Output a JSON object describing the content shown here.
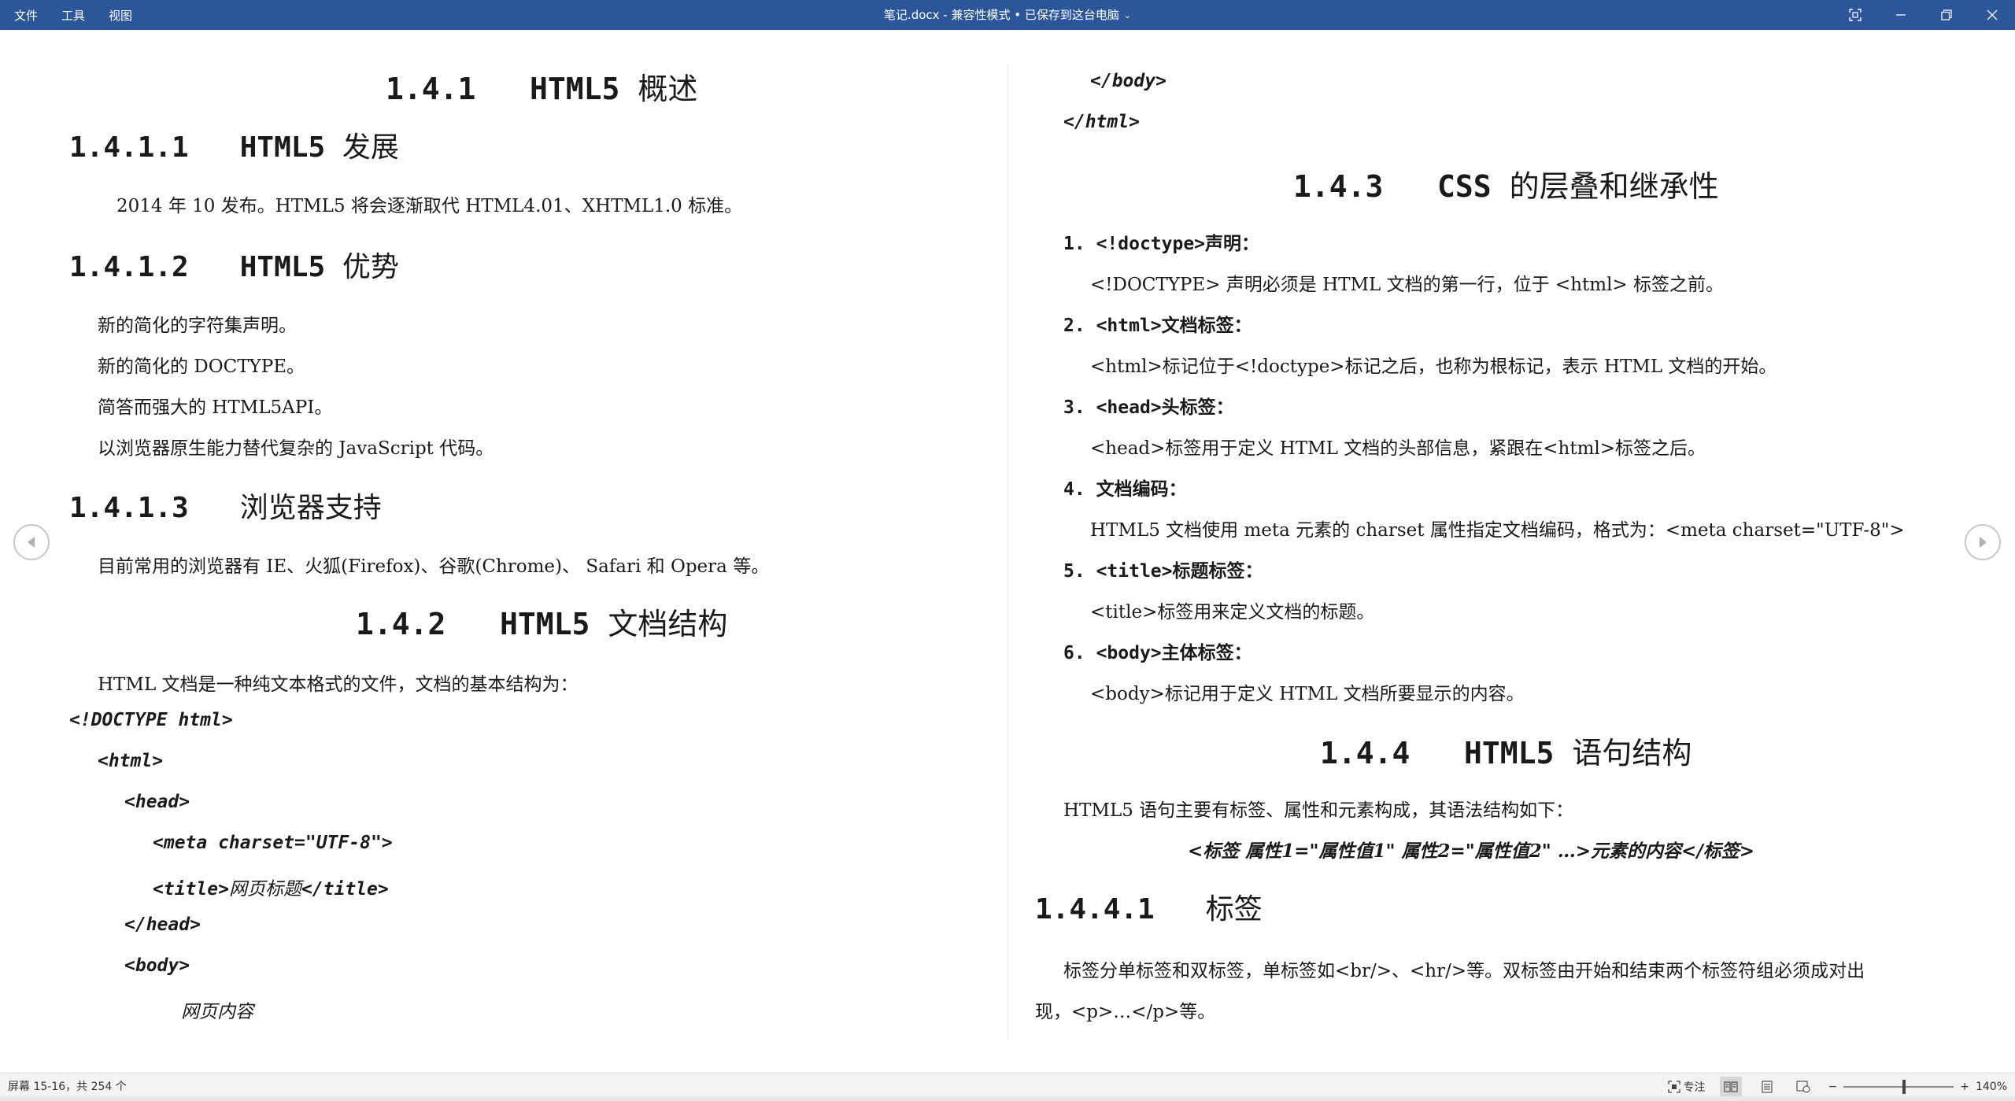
{
  "titlebar": {
    "menu": [
      "文件",
      "工具",
      "视图"
    ],
    "title": "笔记.docx - 兼容性模式 • 已保存到这台电脑",
    "controls": [
      "fit-window-icon",
      "minimize-icon",
      "restore-icon",
      "close-icon"
    ]
  },
  "left": {
    "h_141": {
      "num": "1.4.1",
      "mono": "HTML5",
      "cn": "概述"
    },
    "h_1411": {
      "num": "1.4.1.1",
      "mono": "HTML5",
      "cn": "发展"
    },
    "p_1411": "2014 年 10 发布。HTML5 将会逐渐取代 HTML4.01、XHTML1.0 标准。",
    "h_1412": {
      "num": "1.4.1.2",
      "mono": "HTML5",
      "cn": "优势"
    },
    "adv": [
      "新的简化的字符集声明。",
      "新的简化的 DOCTYPE。",
      "简答而强大的 HTML5API。",
      "以浏览器原生能力替代复杂的 JavaScript 代码。"
    ],
    "h_1413": {
      "num": "1.4.1.3",
      "cn": "浏览器支持"
    },
    "p_1413": "目前常用的浏览器有 IE、火狐(Firefox)、谷歌(Chrome)、 Safari 和 Opera 等。",
    "h_142": {
      "num": "1.4.2",
      "mono": "HTML5",
      "cn": "文档结构"
    },
    "p_142": "HTML 文档是一种纯文本格式的文件，文档的基本结构为：",
    "code": [
      "<!DOCTYPE html>",
      "<html>",
      "<head>",
      "<meta charset=\"UTF-8\">",
      "<title>",
      "网页标题",
      "</title>",
      "</head>",
      "<body>",
      "网页内容"
    ]
  },
  "right": {
    "code_tail": [
      "</body>",
      "</html>"
    ],
    "h_143": {
      "num": "1.4.3",
      "mono": "CSS",
      "cn": "的层叠和继承性"
    },
    "items": [
      {
        "n": "1.",
        "title": "<!doctype>声明：",
        "desc": "<!DOCTYPE> 声明必须是 HTML 文档的第一行，位于 <html> 标签之前。"
      },
      {
        "n": "2.",
        "title": "<html>文档标签：",
        "desc": "<html>标记位于<!doctype>标记之后，也称为根标记，表示 HTML 文档的开始。"
      },
      {
        "n": "3.",
        "title": "<head>头标签：",
        "desc": "<head>标签用于定义 HTML 文档的头部信息，紧跟在<html>标签之后。"
      },
      {
        "n": "4.",
        "title": "文档编码：",
        "desc": "HTML5 文档使用 meta 元素的 charset 属性指定文档编码，格式为：<meta charset=\"UTF-8\">"
      },
      {
        "n": "5.",
        "title": "<title>标题标签：",
        "desc": "<title>标签用来定义文档的标题。"
      },
      {
        "n": "6.",
        "title": "<body>主体标签：",
        "desc": "<body>标记用于定义 HTML 文档所要显示的内容。"
      }
    ],
    "h_144": {
      "num": "1.4.4",
      "mono": "HTML5",
      "cn": "语句结构"
    },
    "p_144": "HTML5 语句主要有标签、属性和元素构成，其语法结构如下：",
    "syntax": "<标签 属性1=\"属性值1\" 属性2=\"属性值2\" …>元素的内容</标签>",
    "h_1441": {
      "num": "1.4.4.1",
      "cn": "标签"
    },
    "p_1441_a": "标签分单标签和双标签，单标签如<br/>、<hr/>等。双标签由开始和结束两个标签符组必须成对出",
    "p_1441_b": "现，<p>…</p>等。"
  },
  "status": {
    "page": "屏幕 15-16，共 254 个",
    "focus": "专注",
    "zoom": "140%",
    "zoom_level_percent": 140
  }
}
